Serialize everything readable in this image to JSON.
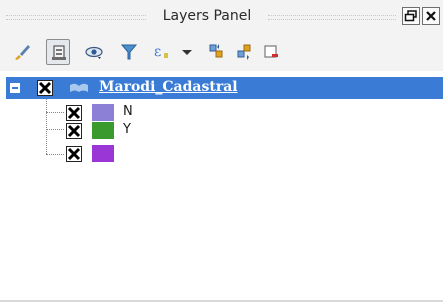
{
  "panel": {
    "title": "Layers Panel"
  },
  "toolbar": {
    "tools": [
      {
        "icon": "paintbrush-icon",
        "pressed": false
      },
      {
        "icon": "add-group-icon",
        "pressed": true
      },
      {
        "icon": "eye-icon",
        "pressed": false
      },
      {
        "icon": "filter-icon",
        "pressed": false
      },
      {
        "icon": "expression-filter-icon",
        "pressed": false
      },
      {
        "icon": "dropdown-arrow-icon",
        "pressed": false
      },
      {
        "icon": "expand-all-icon",
        "pressed": false
      },
      {
        "icon": "collapse-all-icon",
        "pressed": false
      },
      {
        "icon": "remove-layer-icon",
        "pressed": false
      }
    ]
  },
  "layers": [
    {
      "name": "Marodi_Cadastral",
      "checked": true,
      "selected": true,
      "classes": [
        {
          "label": "N",
          "color": "#8c7fd6",
          "checked": true
        },
        {
          "label": "Y",
          "color": "#3a9a2e",
          "checked": true
        },
        {
          "label": "",
          "color": "#9a35d6",
          "checked": true
        }
      ]
    }
  ],
  "colors": {
    "selection": "#3a7bd5",
    "background": "#ffffff",
    "chrome": "#f3f3f3"
  }
}
